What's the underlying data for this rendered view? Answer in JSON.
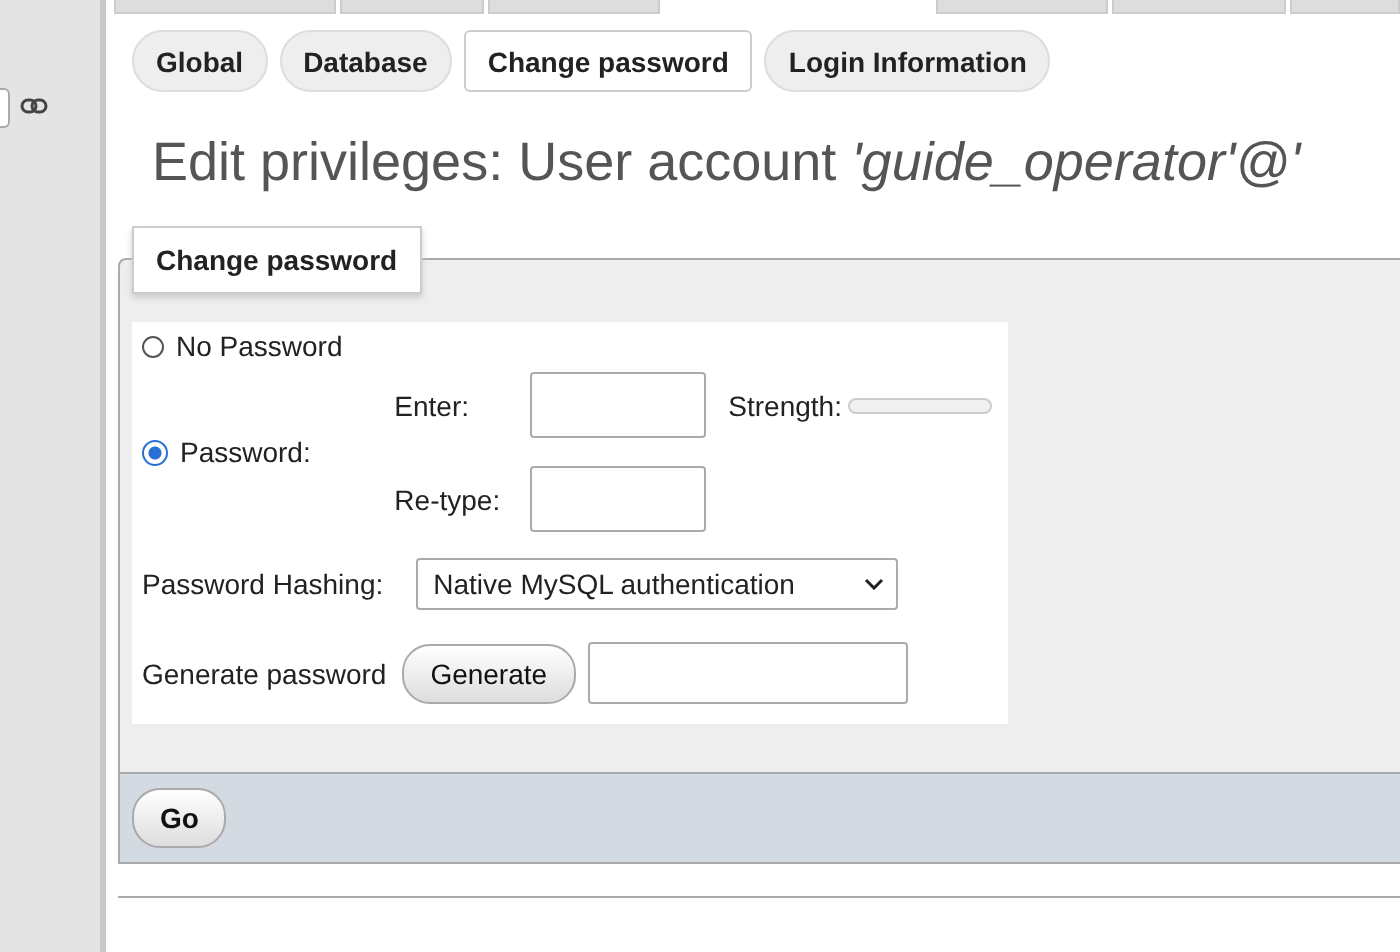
{
  "tabs": [
    {
      "label": "Global",
      "selected": false
    },
    {
      "label": "Database",
      "selected": false
    },
    {
      "label": "Change password",
      "selected": true
    },
    {
      "label": "Login Information",
      "selected": false
    }
  ],
  "heading": "Edit privileges: User account *'guide_operator'@'*",
  "form": {
    "legend": "Change password",
    "options": [
      {
        "label": "No Password",
        "selected": false
      },
      {
        "label": "Password:",
        "selected": true
      }
    ],
    "enter_label": "Enter:",
    "retype_label": "Re-type:",
    "strength_label": "Strength:",
    "hashing_label": "Password Hashing:",
    "hashing_value": "Native MySQL authentication",
    "generate_label": "Generate password",
    "generate_button": "Generate"
  },
  "go_button": "Go"
}
